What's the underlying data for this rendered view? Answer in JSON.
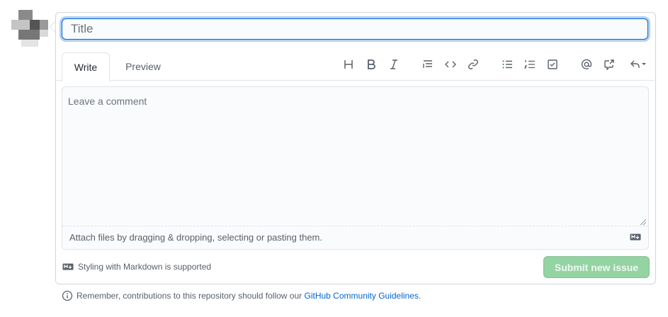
{
  "colors": {
    "accent": "#0366d6",
    "border": "#d1d5da",
    "muted_text": "#586069",
    "submit_disabled_bg": "#94d3a2"
  },
  "form": {
    "title_placeholder": "Title",
    "title_value": "",
    "tabs": [
      {
        "label": "Write",
        "selected": true
      },
      {
        "label": "Preview",
        "selected": false
      }
    ],
    "toolbar": [
      {
        "icon": "heading-icon"
      },
      {
        "icon": "bold-icon"
      },
      {
        "icon": "italic-icon"
      },
      {
        "icon": "quote-icon"
      },
      {
        "icon": "code-icon"
      },
      {
        "icon": "link-icon"
      },
      {
        "icon": "bulleted-list-icon"
      },
      {
        "icon": "numbered-list-icon"
      },
      {
        "icon": "task-list-icon"
      },
      {
        "icon": "mention-icon"
      },
      {
        "icon": "cross-reference-icon"
      },
      {
        "icon": "saved-replies-icon"
      }
    ],
    "comment_placeholder": "Leave a comment",
    "attach_text": "Attach files by dragging & dropping, selecting or pasting them.",
    "markdown_note": "Styling with Markdown is supported",
    "submit_label": "Submit new issue",
    "submit_disabled": true
  },
  "footer": {
    "text_before": "Remember, contributions to this repository should follow our",
    "link_text": "GitHub Community Guidelines",
    "text_after": "."
  }
}
